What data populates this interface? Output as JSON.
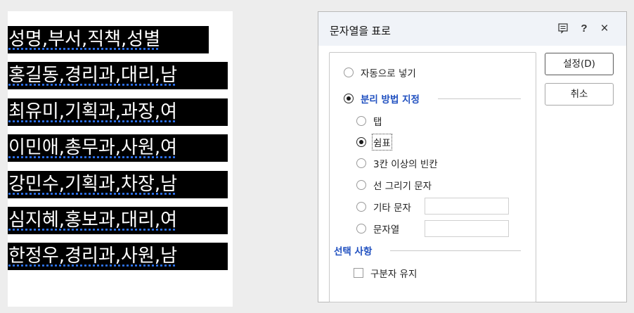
{
  "document": {
    "lines": [
      "성명,부서,직책,성별",
      "홍길동,경리과,대리,남",
      "최유미,기획과,과장,여",
      "이민애,총무과,사원,여",
      "강민수,기획과,차장,남",
      "심지혜,홍보과,대리,여",
      "한정우,경리과,사원,남"
    ]
  },
  "dialog": {
    "title": "문자열을 표로",
    "icons": [
      "memo-icon",
      "help-icon",
      "close-icon"
    ],
    "help_glyph": "?",
    "close_glyph": "×",
    "auto_fill_label": "자동으로 넣기",
    "separator_section_label": "분리 방법 지정",
    "options": {
      "tab": "탭",
      "comma": "쉼표",
      "spaces": "3칸 이상의 빈칸",
      "line_char": "선 그리기 문자",
      "other_char": "기타 문자",
      "string": "문자열"
    },
    "selected_separator": "comma",
    "other_char_value": "",
    "string_value": "",
    "choices_section_label": "선택 사항",
    "keep_separator_label": "구분자 유지",
    "keep_separator_checked": false,
    "ok_label": "설정(D)",
    "cancel_label": "취소"
  }
}
